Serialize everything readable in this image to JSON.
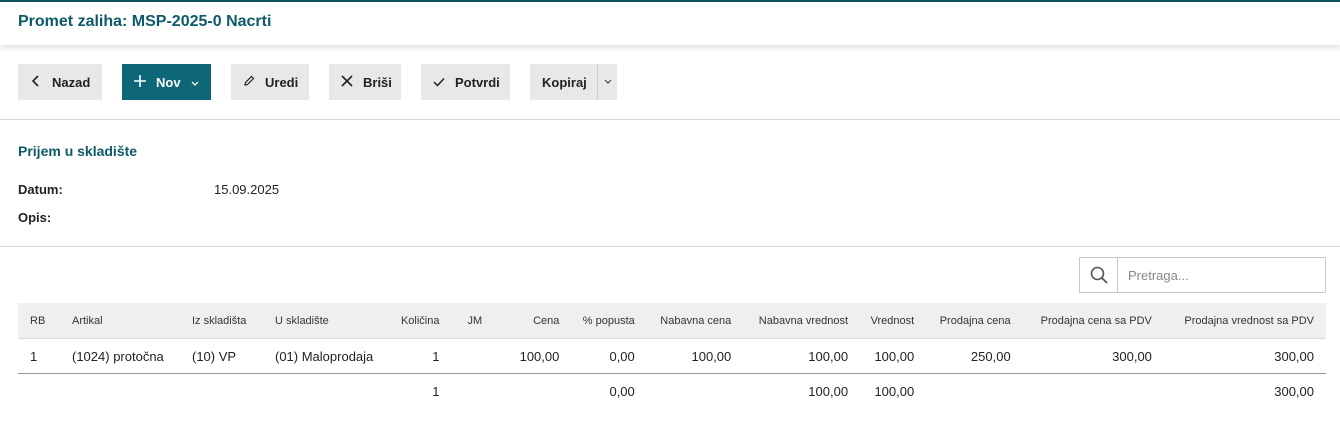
{
  "header": {
    "title": "Promet zaliha: MSP-2025-0 Nacrti"
  },
  "toolbar": {
    "back_label": "Nazad",
    "new_label": "Nov",
    "edit_label": "Uredi",
    "delete_label": "Briši",
    "confirm_label": "Potvrdi",
    "copy_label": "Kopiraj"
  },
  "document": {
    "section_title": "Prijem u skladište",
    "date_label": "Datum:",
    "date_value": "15.09.2025",
    "desc_label": "Opis:"
  },
  "search": {
    "placeholder": "Pretraga..."
  },
  "table": {
    "columns": [
      "RB",
      "Artikal",
      "Iz skladišta",
      "U skladište",
      "Količina",
      "JM",
      "Cena",
      "% popusta",
      "Nabavna cena",
      "Nabavna vrednost",
      "Vrednost",
      "Prodajna cena",
      "Prodajna cena sa PDV",
      "Prodajna vrednost sa PDV"
    ],
    "rows": [
      [
        "1",
        "(1024) protočna",
        "(10) VP",
        "(01) Maloprodaja",
        "1",
        "",
        "100,00",
        "0,00",
        "100,00",
        "100,00",
        "100,00",
        "250,00",
        "300,00",
        "300,00"
      ]
    ],
    "totals": [
      "",
      "",
      "",
      "",
      "1",
      "",
      "",
      "0,00",
      "",
      "100,00",
      "100,00",
      "",
      "",
      "300,00"
    ]
  },
  "colors": {
    "accent": "#0d6777",
    "title": "#0d5a6a"
  }
}
